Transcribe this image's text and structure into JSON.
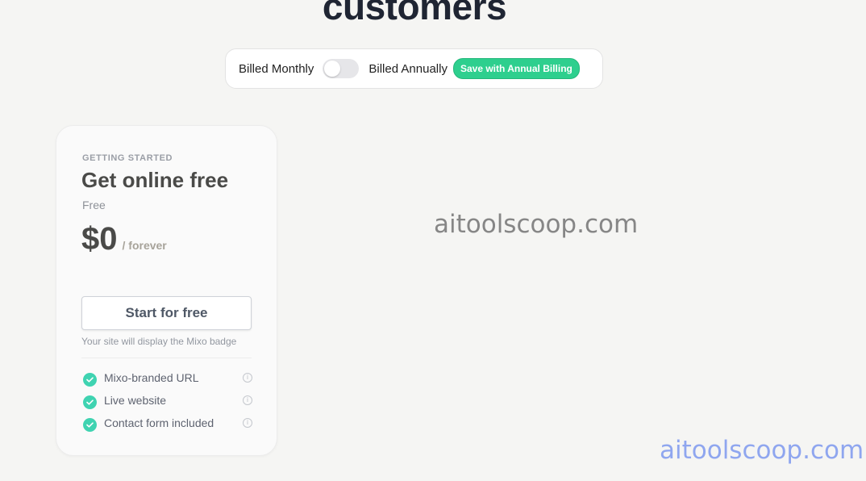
{
  "page": {
    "heading": "customers"
  },
  "billing": {
    "monthly_label": "Billed Monthly",
    "annual_label": "Billed Annually",
    "save_badge": "Save with Annual Billing",
    "toggle_state": "monthly"
  },
  "plan": {
    "eyebrow": "GETTING STARTED",
    "title": "Get online free",
    "subtitle": "Free",
    "price": "$0",
    "period": "/ forever",
    "cta_label": "Start for free",
    "badge_note": "Your site will display the Mixo badge",
    "features": [
      {
        "label": "Mixo-branded URL",
        "icon": "info-icon"
      },
      {
        "label": "Live website",
        "icon": "info-icon"
      },
      {
        "label": "Contact form included",
        "icon": "info-icon"
      }
    ]
  },
  "watermarks": {
    "center": "aitoolscoop.com",
    "corner": "aitoolscoop.com"
  },
  "colors": {
    "background": "#f5f5f3",
    "accent_green": "#2ecf8e",
    "check_teal": "#3fd3b1",
    "heading": "#1f2533"
  }
}
